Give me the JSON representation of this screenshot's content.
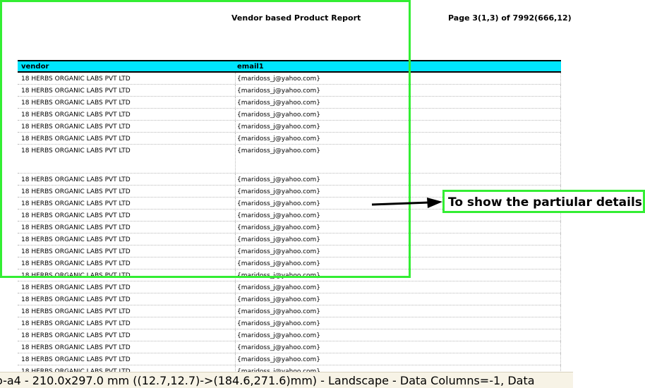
{
  "report": {
    "title": "Vendor based Product Report",
    "page_info": "Page 3(1,3) of 7992(666,12)"
  },
  "table": {
    "headers": [
      "vendor",
      "email1"
    ],
    "rows": [
      [
        "18 HERBS ORGANIC LABS PVT LTD",
        "{maridoss_j@yahoo.com}"
      ],
      [
        "18 HERBS ORGANIC LABS PVT LTD",
        "{maridoss_j@yahoo.com}"
      ],
      [
        "18 HERBS ORGANIC LABS PVT LTD",
        "{maridoss_j@yahoo.com}"
      ],
      [
        "18 HERBS ORGANIC LABS PVT LTD",
        "{maridoss_j@yahoo.com}"
      ],
      [
        "18 HERBS ORGANIC LABS PVT LTD",
        "{maridoss_j@yahoo.com}"
      ],
      [
        "18 HERBS ORGANIC LABS PVT LTD",
        "{maridoss_j@yahoo.com}"
      ],
      [
        "18 HERBS ORGANIC LABS PVT LTD",
        "{maridoss_j@yahoo.com}"
      ],
      [
        "18 HERBS ORGANIC LABS PVT LTD",
        "{maridoss_j@yahoo.com}"
      ],
      [
        "18 HERBS ORGANIC LABS PVT LTD",
        "{maridoss_j@yahoo.com}"
      ],
      [
        "18 HERBS ORGANIC LABS PVT LTD",
        "{maridoss_j@yahoo.com}"
      ],
      [
        "18 HERBS ORGANIC LABS PVT LTD",
        "{maridoss_j@yahoo.com}"
      ],
      [
        "18 HERBS ORGANIC LABS PVT LTD",
        "{maridoss_j@yahoo.com}"
      ],
      [
        "18 HERBS ORGANIC LABS PVT LTD",
        "{maridoss_j@yahoo.com}"
      ],
      [
        "18 HERBS ORGANIC LABS PVT LTD",
        "{maridoss_j@yahoo.com}"
      ],
      [
        "18 HERBS ORGANIC LABS PVT LTD",
        "{maridoss_j@yahoo.com}"
      ],
      [
        "18 HERBS ORGANIC LABS PVT LTD",
        "{maridoss_j@yahoo.com}"
      ],
      [
        "18 HERBS ORGANIC LABS PVT LTD",
        "{maridoss_j@yahoo.com}"
      ],
      [
        "18 HERBS ORGANIC LABS PVT LTD",
        "{maridoss_j@yahoo.com}"
      ],
      [
        "18 HERBS ORGANIC LABS PVT LTD",
        "{maridoss_j@yahoo.com}"
      ],
      [
        "18 HERBS ORGANIC LABS PVT LTD",
        "{maridoss_j@yahoo.com}"
      ],
      [
        "18 HERBS ORGANIC LABS PVT LTD",
        "{maridoss_j@yahoo.com}"
      ],
      [
        "18 HERBS ORGANIC LABS PVT LTD",
        "{maridoss_j@yahoo.com}"
      ],
      [
        "18 HERBS ORGANIC LABS PVT LTD",
        "{maridoss_j@yahoo.com}"
      ],
      [
        "18 HERBS ORGANIC LABS PVT LTD",
        "{maridoss_j@yahoo.com}"
      ]
    ]
  },
  "annotation": {
    "callout_text": "To show the partiular details",
    "color": "#33ee33"
  },
  "status_bar": {
    "text": "o-a4 - 210.0x297.0 mm ((12.7,12.7)->(184.6,271.6)mm) - Landscape - Data Columns=-1, Data"
  },
  "colors": {
    "header_bg": "#00e5ff"
  }
}
